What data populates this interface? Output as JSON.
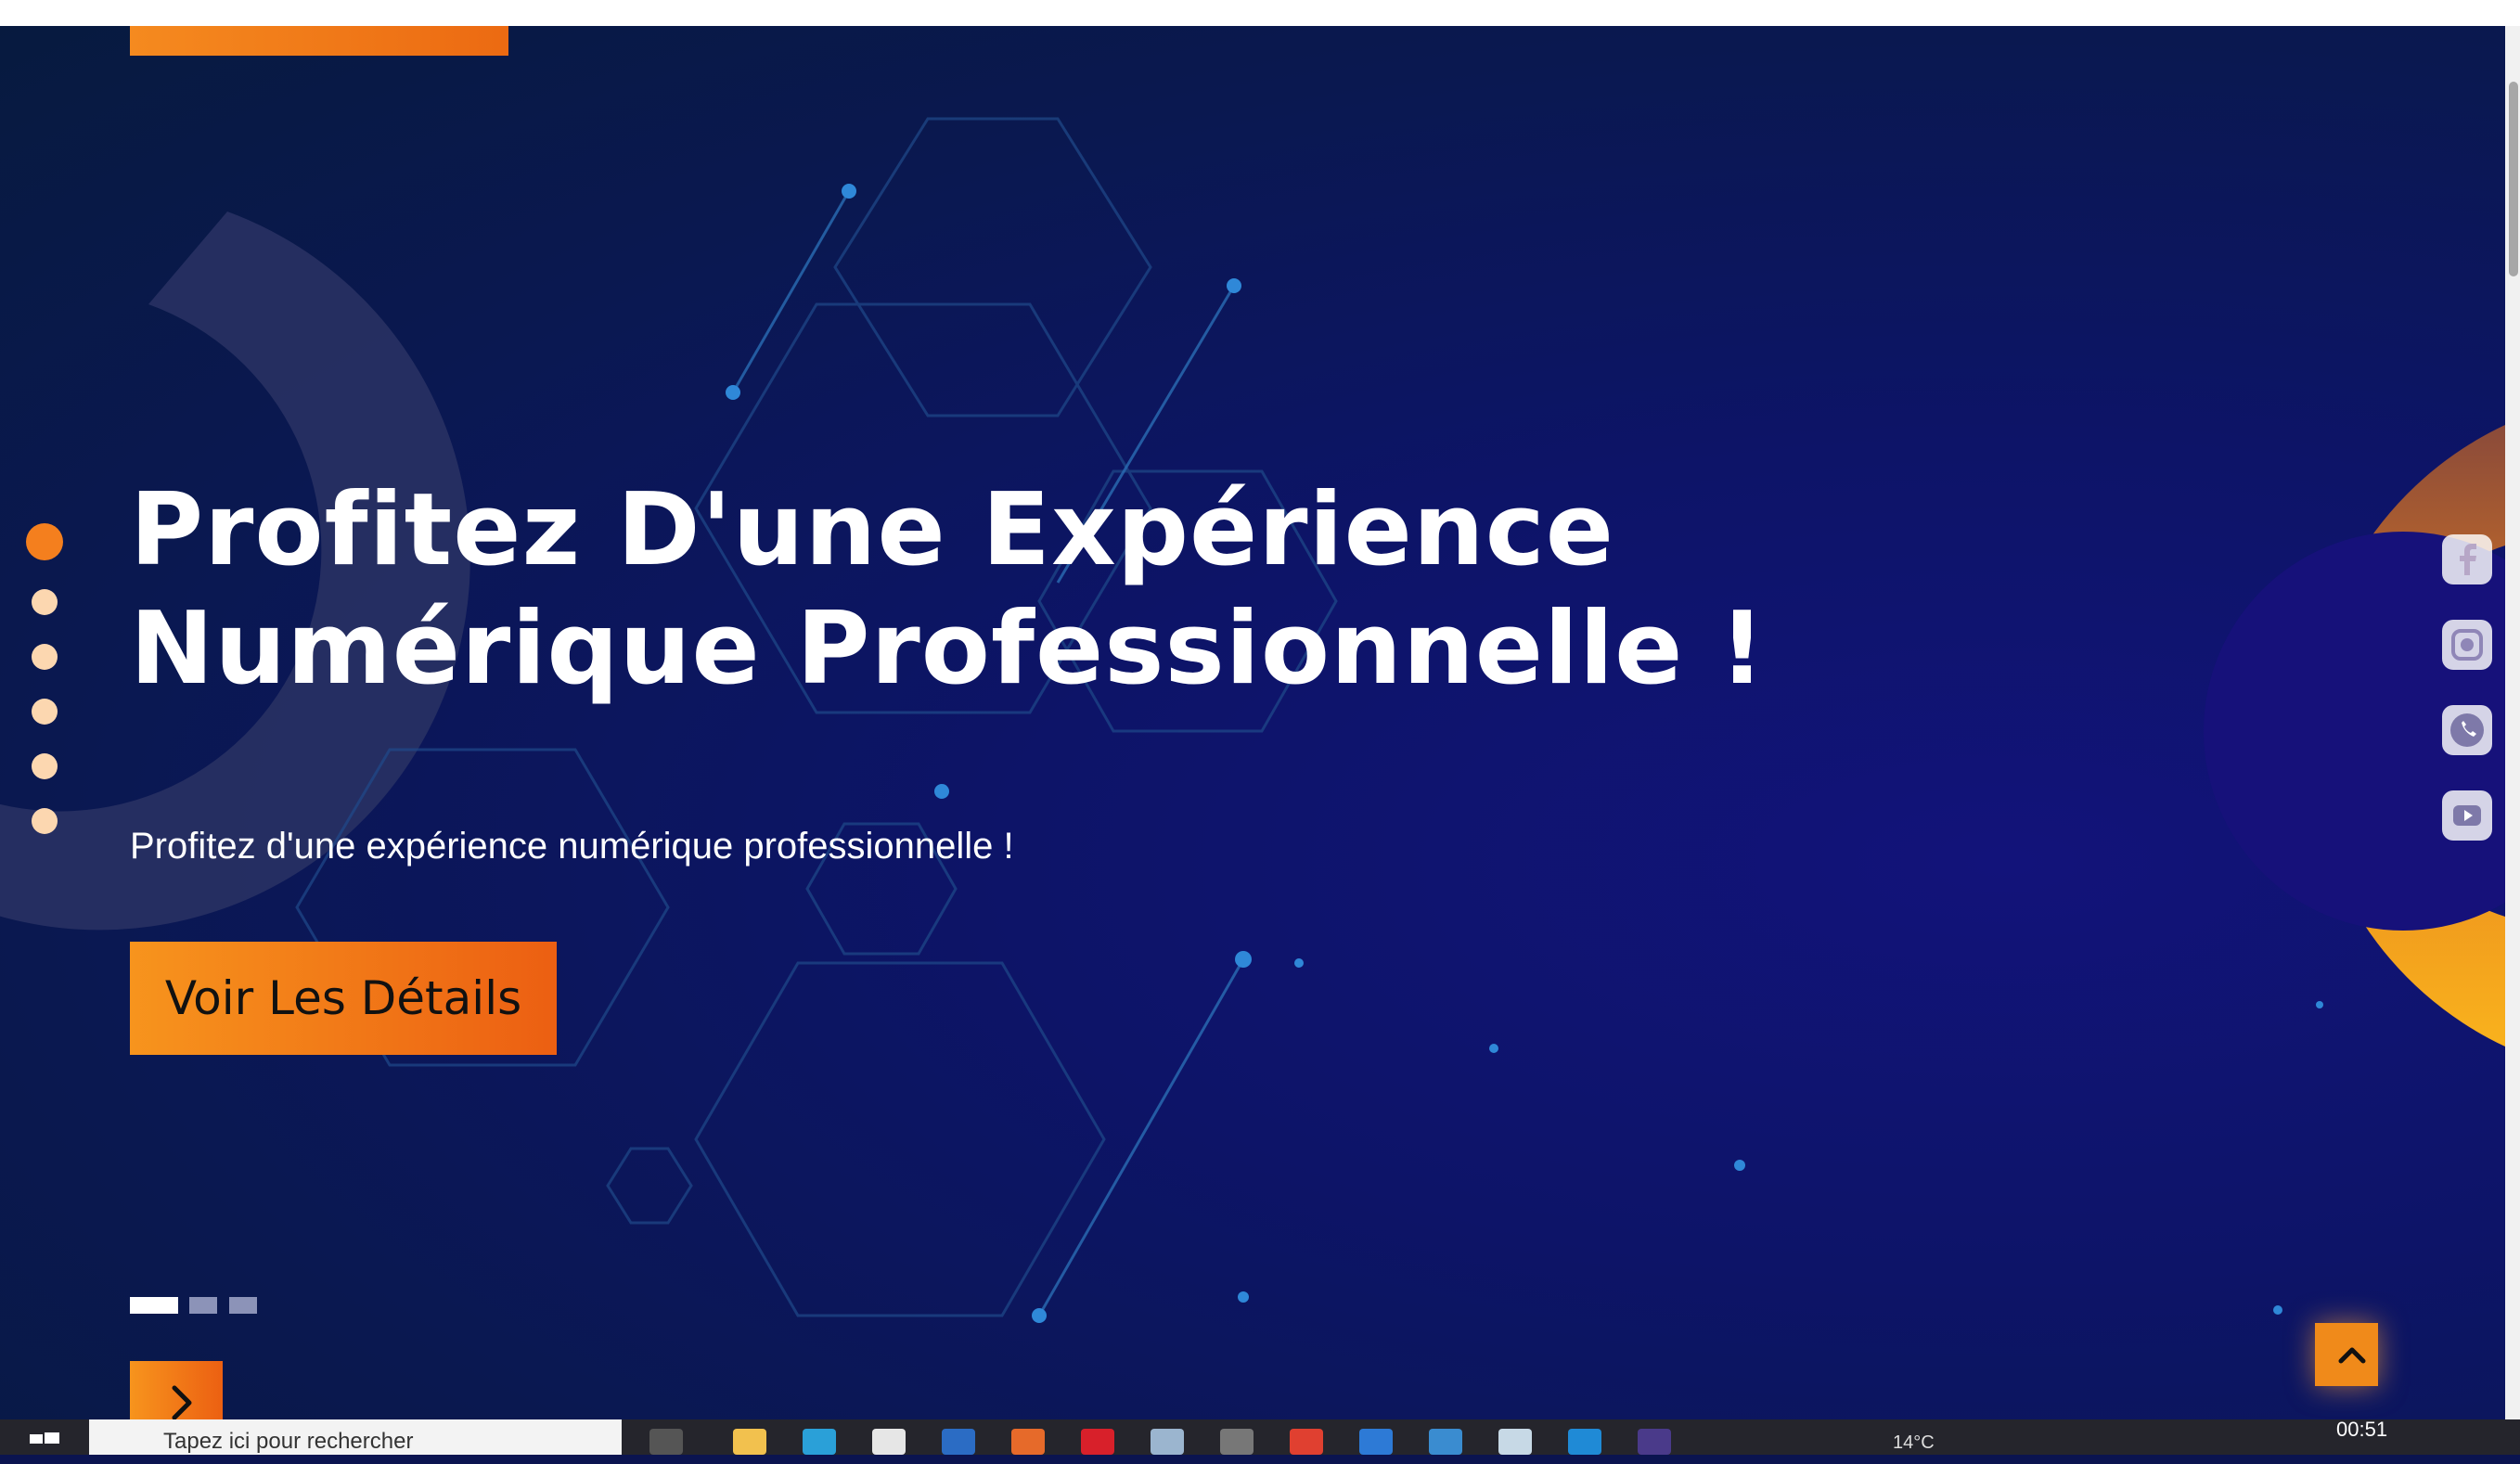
{
  "hero": {
    "title_line1": "Profitez D'une Expérience",
    "title_line2": "Numérique Professionnelle !",
    "subtitle": "Profitez d'une expérience numérique professionnelle !",
    "cta_label": "Voir Les Détails"
  },
  "pager": {
    "count": 6,
    "active_index": 0
  },
  "slides": {
    "count": 3,
    "active_index": 0
  },
  "social": [
    "facebook-icon",
    "instagram-icon",
    "whatsapp-icon",
    "youtube-icon"
  ],
  "taskbar": {
    "clock": "00:51",
    "temperature": "14°C",
    "search_placeholder": "Tapez ici pour rechercher"
  },
  "colors": {
    "accent_orange": "#f47f1e",
    "background_navy": "#0b1450",
    "text": "#ffffff"
  }
}
